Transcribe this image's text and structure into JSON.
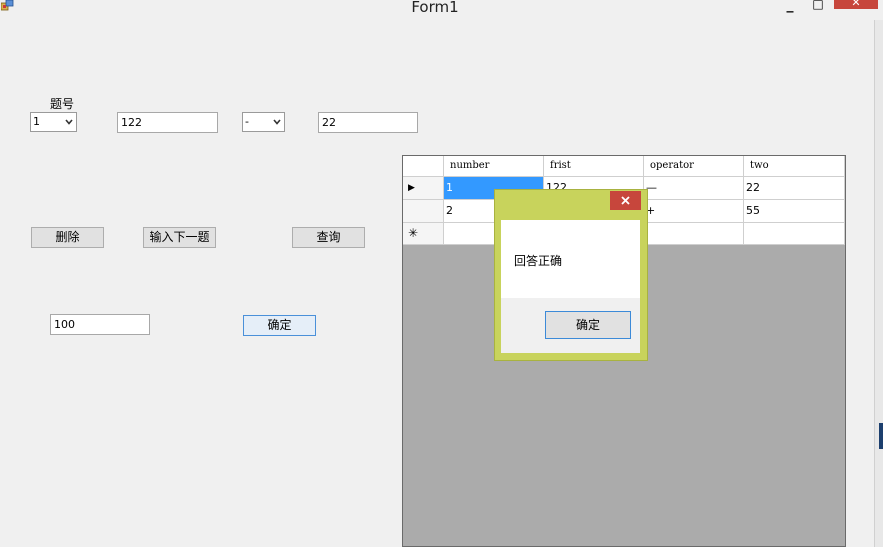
{
  "window": {
    "title": "Form1",
    "minimize": "_",
    "maximize": "□",
    "close": "✕"
  },
  "form": {
    "question_label": "题号",
    "question_combo": {
      "selected": "1"
    },
    "first_number": "122",
    "operator_combo": {
      "selected": "-"
    },
    "second_number": "22",
    "delete_button": "删除",
    "next_button": "输入下一题",
    "query_button": "查询",
    "answer_input": "100",
    "confirm_button": "确定"
  },
  "grid": {
    "columns": [
      "number",
      "frist",
      "operator",
      "two"
    ],
    "rows": [
      {
        "marker": "▶",
        "cells": [
          "1",
          "122",
          "—",
          "22"
        ]
      },
      {
        "marker": "",
        "cells": [
          "2",
          "",
          "+",
          "55"
        ]
      },
      {
        "marker": "✳",
        "cells": [
          "",
          "",
          "",
          ""
        ]
      }
    ]
  },
  "dialog": {
    "message": "回答正确",
    "ok_button": "确定",
    "close_icon": "✕"
  },
  "colors": {
    "dialog_frame": "#c8d35c",
    "close_red": "#c7463c",
    "selection": "#3399ff",
    "grid_bg": "#ababab"
  }
}
